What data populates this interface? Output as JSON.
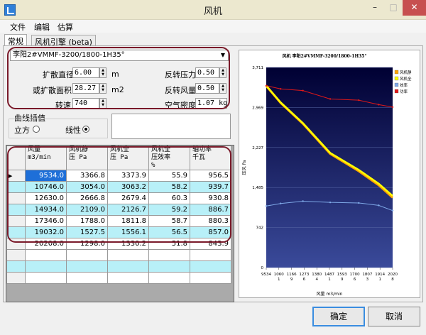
{
  "window": {
    "title": "风机",
    "min_label": "–",
    "max_label": "□",
    "close_label": "✕"
  },
  "menu": [
    "文件",
    "编辑",
    "估算"
  ],
  "tabs": [
    "常规",
    "风机引擎 (beta)"
  ],
  "fan_select": "李阳2#VMMF-3200/1800-1H35°",
  "fields": {
    "diff_dia_label": "扩散直径",
    "diff_dia_value": "6.00",
    "diff_dia_unit": "m",
    "diff_area_label": "或扩散面积",
    "diff_area_value": "28.27",
    "diff_area_unit": "m2",
    "speed_label": "转速",
    "speed_value": "740",
    "rev_press_label": "反转压力",
    "rev_press_value": "0.50",
    "rev_flow_label": "反转风量",
    "rev_flow_value": "0.50",
    "air_density_label": "空气密度",
    "air_density_value": "1.07 kg/"
  },
  "curve": {
    "group_label": "曲线插值",
    "opt_cubic": "立方",
    "opt_linear": "线性"
  },
  "grid": {
    "headers": [
      "风量\nm3/min",
      "风机静\n压 Pa",
      "风机全\n压 Pa",
      "风机全\n压效率\n%",
      "轴功率\n千瓦"
    ],
    "rows": [
      [
        "9534.0",
        "3366.8",
        "3373.9",
        "55.9",
        "956.5"
      ],
      [
        "10746.0",
        "3054.0",
        "3063.2",
        "58.2",
        "939.7"
      ],
      [
        "12630.0",
        "2666.8",
        "2679.4",
        "60.3",
        "930.8"
      ],
      [
        "14934.0",
        "2109.0",
        "2126.7",
        "59.2",
        "886.7"
      ],
      [
        "17346.0",
        "1788.0",
        "1811.8",
        "58.7",
        "880.3"
      ],
      [
        "19032.0",
        "1527.5",
        "1556.1",
        "56.5",
        "857.0"
      ],
      [
        "20208.0",
        "1298.0",
        "1330.2",
        "51.8",
        "843.9"
      ]
    ]
  },
  "buttons": {
    "ok": "确定",
    "cancel": "取消"
  },
  "colors": {
    "chart_bg_top": "#000033",
    "chart_bg_bottom": "#3a4a9a",
    "static": "#ffa500",
    "total": "#ffff00",
    "efficiency": "#7fa9e8",
    "power": "#e01818"
  },
  "chart_data": {
    "type": "line",
    "title": "风机 李阳2#VMMF-3200/1800-1H35°",
    "xlabel": "风量 m3/min",
    "ylabel": "压风 Pa",
    "x_ticks": [
      "9534",
      "1060\n1",
      "1166\n9",
      "1273\n6",
      "1380\n4",
      "1487\n1",
      "1593\n9",
      "1700\n6",
      "1807\n3",
      "1914\n1",
      "2020\n8"
    ],
    "y_ticks": [
      "0",
      "742",
      "1,485",
      "2,227",
      "2,969",
      "3,711"
    ],
    "xlim": [
      9534,
      20208
    ],
    "ylim": [
      0,
      3711
    ],
    "legend": [
      "风机静",
      "风机全",
      "效率",
      "功率"
    ],
    "legend_position": "right",
    "x": [
      9534,
      10746,
      12630,
      14934,
      17346,
      19032,
      20208
    ],
    "series": [
      {
        "name": "风机静",
        "values": [
          3366.8,
          3054.0,
          2666.8,
          2109.0,
          1788.0,
          1527.5,
          1298.0
        ]
      },
      {
        "name": "风机全",
        "values": [
          3373.9,
          3063.2,
          2679.4,
          2126.7,
          1811.8,
          1556.1,
          1330.2
        ]
      },
      {
        "name": "效率",
        "values": [
          55.9,
          58.2,
          60.3,
          59.2,
          58.7,
          56.5,
          51.8
        ]
      },
      {
        "name": "功率",
        "values": [
          956.5,
          939.7,
          930.8,
          886.7,
          880.3,
          857.0,
          843.9
        ]
      }
    ]
  }
}
